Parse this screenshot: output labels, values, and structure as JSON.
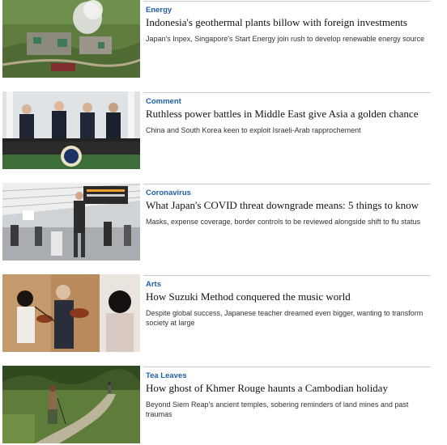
{
  "articles": [
    {
      "category": "Energy",
      "headline": "Indonesia's geothermal plants billow with foreign investments",
      "summary": "Japan's Inpex, Singapore's Start Energy join rush to develop renewable energy source",
      "image": "geothermal-plant-aerial-photo"
    },
    {
      "category": "Comment",
      "headline": "Ruthless power battles in Middle East give Asia a golden chance",
      "summary": "China and South Korea keen to exploit Israeli-Arab rapprochement",
      "image": "leaders-on-balcony-photo"
    },
    {
      "category": "Coronavirus",
      "headline": "What Japan's COVID threat downgrade means: 5 things to know",
      "summary": "Masks, expense coverage, border controls to be reviewed alongside shift to flu status",
      "image": "train-station-commuters-photo"
    },
    {
      "category": "Arts",
      "headline": "How Suzuki Method conquered the music world",
      "summary": "Despite global success, Japanese teacher dreamed even bigger, wanting to transform society at large",
      "image": "violin-lesson-photo"
    },
    {
      "category": "Tea Leaves",
      "headline": "How ghost of Khmer Rouge haunts a Cambodian holiday",
      "summary": "Beyond Siem Reap's ancient temples, sobering reminders of land mines and past traumas",
      "image": "jungle-path-walker-photo"
    }
  ]
}
